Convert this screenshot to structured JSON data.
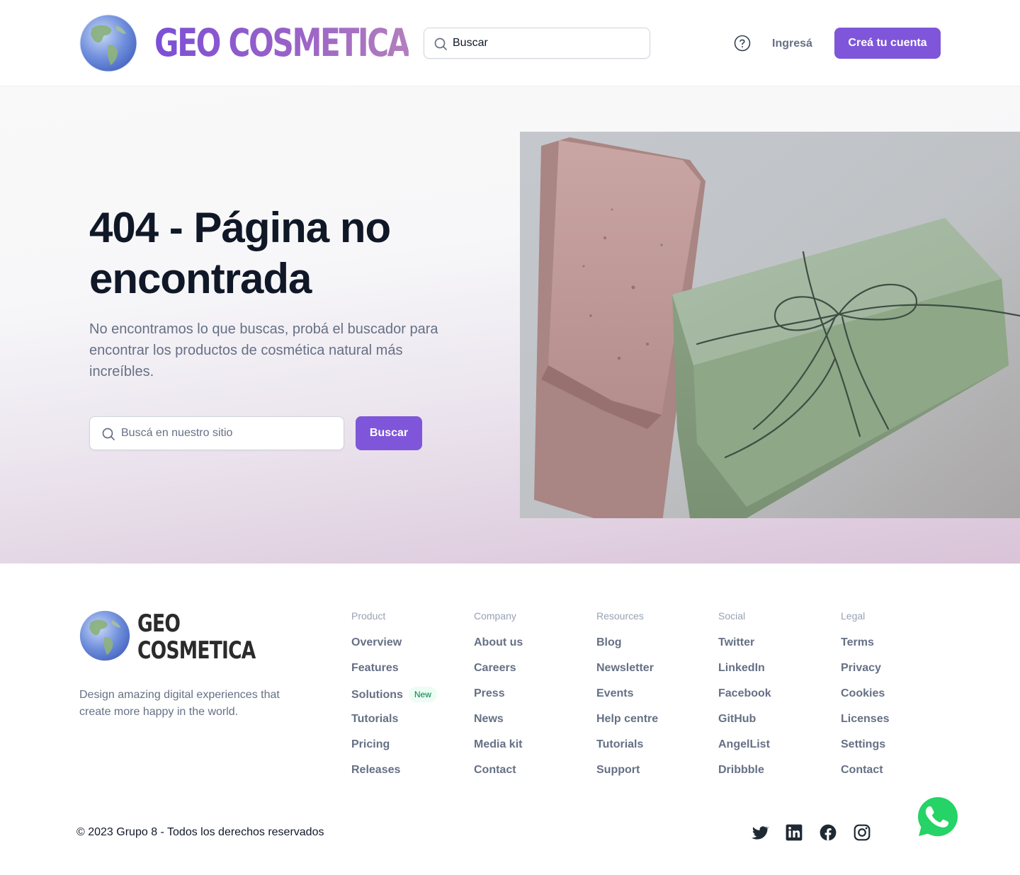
{
  "header": {
    "brand": "GEO COSMETICA",
    "search_placeholder": "Buscar",
    "help_icon": "help-circle-icon",
    "login_label": "Ingresá",
    "signup_label": "Creá tu cuenta"
  },
  "hero": {
    "title": "404 - Página no encontrada",
    "description": "No encontramos lo que buscas, probá el buscador para encontrar los productos de cosmética natural más increíbles.",
    "search_placeholder": "Buscá en nuestro sitio",
    "button_label": "Buscar",
    "image": "soap-bars-photo"
  },
  "footer": {
    "brand_line1": "GEO",
    "brand_line2": "COSMETICA",
    "tagline": "Design amazing digital experiences that create more happy in the world.",
    "columns": [
      {
        "title": "Product",
        "links": [
          "Overview",
          "Features",
          "Solutions",
          "Tutorials",
          "Pricing",
          "Releases"
        ],
        "badge": "New"
      },
      {
        "title": "Company",
        "links": [
          "About us",
          "Careers",
          "Press",
          "News",
          "Media kit",
          "Contact"
        ]
      },
      {
        "title": "Resources",
        "links": [
          "Blog",
          "Newsletter",
          "Events",
          "Help centre",
          "Tutorials",
          "Support"
        ]
      },
      {
        "title": "Social",
        "links": [
          "Twitter",
          "LinkedIn",
          "Facebook",
          "GitHub",
          "AngelList",
          "Dribbble"
        ]
      },
      {
        "title": "Legal",
        "links": [
          "Terms",
          "Privacy",
          "Cookies",
          "Licenses",
          "Settings",
          "Contact"
        ]
      }
    ],
    "copyright": "© 2023 Grupo 8 - Todos los derechos reservados",
    "social_icons": [
      "twitter-icon",
      "linkedin-icon",
      "facebook-icon",
      "instagram-icon"
    ],
    "whatsapp_icon": "whatsapp-icon"
  },
  "colors": {
    "primary": "#7f56d9",
    "text_dark": "#101828",
    "text_muted": "#667085",
    "badge_bg": "#ecfdf3",
    "badge_text": "#027a48",
    "whatsapp": "#25d366"
  }
}
